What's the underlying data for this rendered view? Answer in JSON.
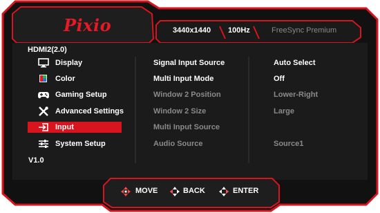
{
  "brand": {
    "logo": "Pixio",
    "accent": "#e61a25"
  },
  "header": {
    "resolution": "3440x1440",
    "refresh": "100Hz",
    "freesync": "FreeSync Premium"
  },
  "source_label": "HDMI2(2.0)",
  "version": "V1.0",
  "menu": [
    {
      "label": "Display",
      "icon": "monitor-icon"
    },
    {
      "label": "Color",
      "icon": "color-swatch-icon"
    },
    {
      "label": "Gaming Setup",
      "icon": "gamepad-icon"
    },
    {
      "label": "Advanced Settings",
      "icon": "tools-icon"
    },
    {
      "label": "Input",
      "icon": "input-icon",
      "selected": true
    },
    {
      "label": "System Setup",
      "icon": "sliders-icon"
    }
  ],
  "options": [
    {
      "label": "Signal Input Source",
      "value": "Auto Select",
      "enabled": true
    },
    {
      "label": "Multi Input Mode",
      "value": "Off",
      "enabled": true
    },
    {
      "label": "Window 2 Position",
      "value": "Lower-Right",
      "enabled": false
    },
    {
      "label": "Window 2 Size",
      "value": "Large",
      "enabled": false
    },
    {
      "label": "Multi Input Source",
      "value": "",
      "enabled": false
    },
    {
      "label": "Audio Source",
      "value": "Source1",
      "enabled": false
    }
  ],
  "footer": {
    "move": "MOVE",
    "back": "BACK",
    "enter": "ENTER"
  }
}
